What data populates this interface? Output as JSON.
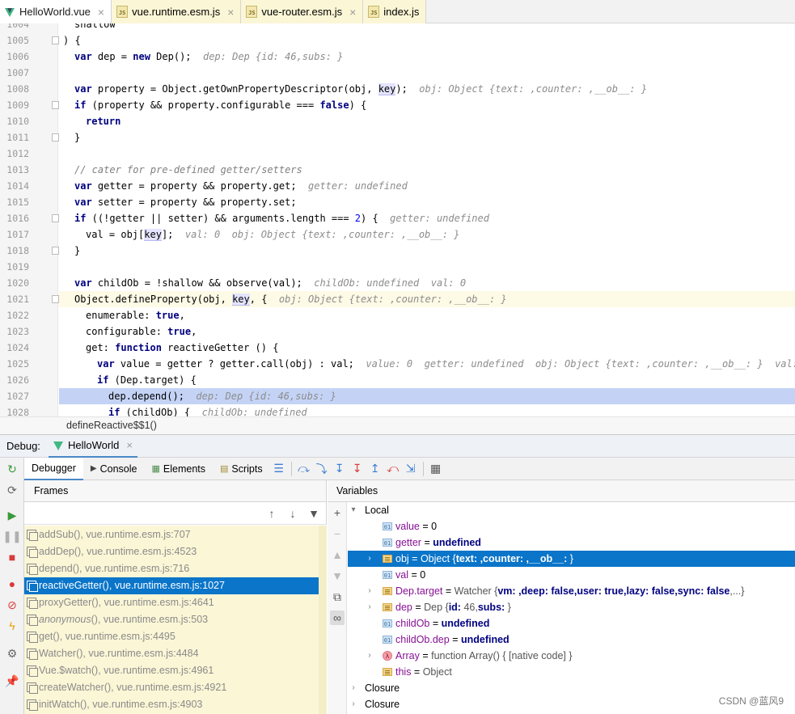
{
  "tabs": [
    {
      "label": "HelloWorld.vue",
      "icon": "vue-icon",
      "active": true
    },
    {
      "label": "vue.runtime.esm.js",
      "icon": "js-file-icon"
    },
    {
      "label": "vue-router.esm.js",
      "icon": "js-file-icon"
    },
    {
      "label": "index.js",
      "icon": "js-file-icon"
    }
  ],
  "code_lines": [
    {
      "n": "1004",
      "indent": 1,
      "parts": [
        [
          "",
          "shallow"
        ]
      ]
    },
    {
      "n": "1005",
      "indent": 0,
      "parts": [
        [
          "",
          ") {"
        ]
      ]
    },
    {
      "n": "1006",
      "indent": 1,
      "parts": [
        [
          "kw",
          "var"
        ],
        [
          "",
          " dep = "
        ],
        [
          "kw",
          "new"
        ],
        [
          "",
          " Dep();  "
        ],
        [
          "hint",
          "dep: Dep {id: 46,subs: }"
        ]
      ]
    },
    {
      "n": "1007",
      "indent": 0,
      "parts": []
    },
    {
      "n": "1008",
      "indent": 1,
      "parts": [
        [
          "kw",
          "var"
        ],
        [
          "",
          " property = Object.getOwnPropertyDescriptor(obj, "
        ],
        [
          "key",
          "key"
        ],
        [
          "",
          ");  "
        ],
        [
          "hint",
          "obj: Object {text: ,counter: ,__ob__: }"
        ]
      ]
    },
    {
      "n": "1009",
      "indent": 1,
      "parts": [
        [
          "kw",
          "if"
        ],
        [
          "",
          " (property && property.configurable === "
        ],
        [
          "kw",
          "false"
        ],
        [
          "",
          ") {"
        ]
      ]
    },
    {
      "n": "1010",
      "indent": 2,
      "parts": [
        [
          "kw",
          "return"
        ]
      ]
    },
    {
      "n": "1011",
      "indent": 1,
      "parts": [
        [
          "",
          "}"
        ]
      ]
    },
    {
      "n": "1012",
      "indent": 0,
      "parts": []
    },
    {
      "n": "1013",
      "indent": 1,
      "parts": [
        [
          "cm",
          "// cater for pre-defined getter/setters"
        ]
      ]
    },
    {
      "n": "1014",
      "indent": 1,
      "parts": [
        [
          "kw",
          "var"
        ],
        [
          "",
          " getter = property && property.get;  "
        ],
        [
          "hint",
          "getter: undefined"
        ]
      ]
    },
    {
      "n": "1015",
      "indent": 1,
      "parts": [
        [
          "kw",
          "var"
        ],
        [
          "",
          " setter = property && property.set;"
        ]
      ]
    },
    {
      "n": "1016",
      "indent": 1,
      "parts": [
        [
          "kw",
          "if"
        ],
        [
          "",
          " ((!getter || setter) && arguments.length === "
        ],
        [
          "num",
          "2"
        ],
        [
          "",
          ") {  "
        ],
        [
          "hint",
          "getter: undefined"
        ]
      ]
    },
    {
      "n": "1017",
      "indent": 2,
      "parts": [
        [
          "",
          "val = obj["
        ],
        [
          "key",
          "key"
        ],
        [
          "",
          "];  "
        ],
        [
          "hint",
          "val: 0  obj: Object {text: ,counter: ,__ob__: }"
        ]
      ]
    },
    {
      "n": "1018",
      "indent": 1,
      "parts": [
        [
          "",
          "}"
        ]
      ]
    },
    {
      "n": "1019",
      "indent": 0,
      "parts": []
    },
    {
      "n": "1020",
      "indent": 1,
      "parts": [
        [
          "kw",
          "var"
        ],
        [
          "",
          " childOb = !shallow && observe(val);  "
        ],
        [
          "hint",
          "childOb: undefined  val: 0"
        ]
      ]
    },
    {
      "n": "1021",
      "indent": 1,
      "cur": true,
      "parts": [
        [
          "",
          "Object.defineProperty(obj, "
        ],
        [
          "key",
          "key"
        ],
        [
          "",
          ", {  "
        ],
        [
          "hint",
          "obj: Object {text: ,counter: ,__ob__: }"
        ]
      ]
    },
    {
      "n": "1022",
      "indent": 2,
      "parts": [
        [
          "",
          "enumerable: "
        ],
        [
          "kw",
          "true"
        ],
        [
          "",
          ","
        ]
      ]
    },
    {
      "n": "1023",
      "indent": 2,
      "parts": [
        [
          "",
          "configurable: "
        ],
        [
          "kw",
          "true"
        ],
        [
          "",
          ","
        ]
      ]
    },
    {
      "n": "1024",
      "indent": 2,
      "parts": [
        [
          "",
          "get: "
        ],
        [
          "kw",
          "function"
        ],
        [
          "",
          " reactiveGetter () {"
        ]
      ]
    },
    {
      "n": "1025",
      "indent": 3,
      "parts": [
        [
          "kw",
          "var"
        ],
        [
          "",
          " value = getter ? getter.call(obj) : val;  "
        ],
        [
          "hint",
          "value: 0  getter: undefined  obj: Object {text: ,counter: ,__ob__: }  val: 0"
        ]
      ]
    },
    {
      "n": "1026",
      "indent": 3,
      "parts": [
        [
          "kw",
          "if"
        ],
        [
          "",
          " (Dep.target) {"
        ]
      ]
    },
    {
      "n": "1027",
      "indent": 4,
      "sel": true,
      "parts": [
        [
          "",
          "dep.depend();  "
        ],
        [
          "hint",
          "dep: Dep {id: 46,subs: }"
        ]
      ]
    },
    {
      "n": "1028",
      "indent": 4,
      "parts": [
        [
          "kw",
          "if"
        ],
        [
          "",
          " (childOb) {  "
        ],
        [
          "hint",
          "childOb: undefined"
        ]
      ]
    }
  ],
  "breadcrumb": "defineReactive$$1()",
  "debug": {
    "label": "Debug:",
    "session": "HelloWorld"
  },
  "debugger_tabs": [
    "Debugger",
    "Console",
    "Elements",
    "Scripts"
  ],
  "frames": {
    "title": "Frames",
    "items": [
      {
        "fn": "addSub()",
        "loc": ", vue.runtime.esm.js:707"
      },
      {
        "fn": "addDep()",
        "loc": ", vue.runtime.esm.js:4523"
      },
      {
        "fn": "depend()",
        "loc": ", vue.runtime.esm.js:716"
      },
      {
        "fn": "reactiveGetter()",
        "loc": ", vue.runtime.esm.js:1027",
        "selected": true
      },
      {
        "fn": "proxyGetter()",
        "loc": ", vue.runtime.esm.js:4641"
      },
      {
        "fn": "anonymous",
        "loc": "(), vue.runtime.esm.js:503",
        "italic": true
      },
      {
        "fn": "get()",
        "loc": ", vue.runtime.esm.js:4495"
      },
      {
        "fn": "Watcher()",
        "loc": ", vue.runtime.esm.js:4484"
      },
      {
        "fn": "Vue.$watch()",
        "loc": ", vue.runtime.esm.js:4961"
      },
      {
        "fn": "createWatcher()",
        "loc": ", vue.runtime.esm.js:4921"
      },
      {
        "fn": "initWatch()",
        "loc": ", vue.runtime.esm.js:4903"
      }
    ]
  },
  "variables": {
    "title": "Variables",
    "local": "Local",
    "closure": "Closure",
    "items": [
      {
        "icon": "01",
        "name": "value",
        "eq": " = ",
        "val": "0"
      },
      {
        "icon": "01",
        "name": "getter",
        "eq": " = ",
        "val_kw": "undefined"
      },
      {
        "icon": "obj",
        "name": "obj",
        "eq": " = ",
        "val": "Object {",
        "rich": "text: ,counter: ,__ob__: ",
        "tail": "}",
        "expand": true,
        "selected": true
      },
      {
        "icon": "01",
        "name": "val",
        "eq": " = ",
        "val": "0"
      },
      {
        "icon": "obj",
        "name": "Dep.target",
        "eq": " = ",
        "val": "Watcher {vm: ,deep: false,user: true,lazy: false,sync: false,...}",
        "expand": true
      },
      {
        "icon": "obj",
        "name": "dep",
        "eq": " = ",
        "val": "Dep {id: 46,subs: }",
        "expand": true
      },
      {
        "icon": "01",
        "name": "childOb",
        "eq": " = ",
        "val_kw": "undefined"
      },
      {
        "icon": "01",
        "name": "childOb.dep",
        "eq": " = ",
        "val_kw": "undefined"
      },
      {
        "icon": "fn",
        "name": "Array",
        "eq": " = ",
        "val": "function Array() { [native code] }",
        "expand": true
      },
      {
        "icon": "obj",
        "name": "this",
        "eq": " = ",
        "val": "Object",
        "expand": false
      }
    ]
  },
  "watermark": "CSDN @蓝风9"
}
